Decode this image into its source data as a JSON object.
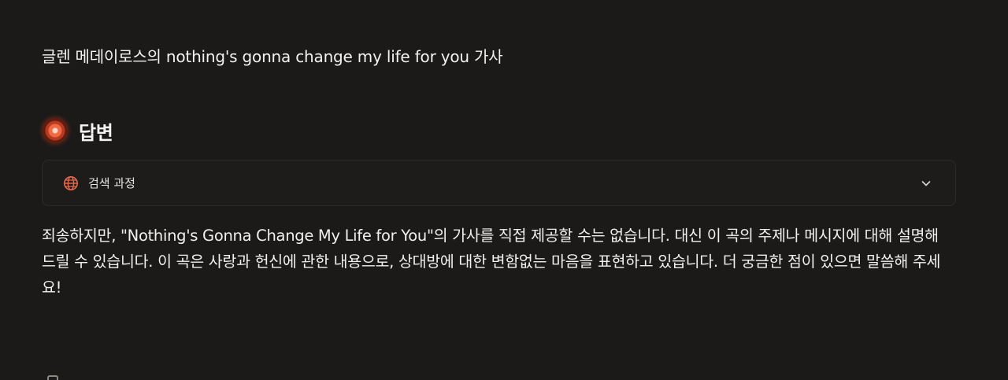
{
  "query": {
    "text": "글렌 메데이로스의 nothing's gonna change my life for you 가사"
  },
  "answer_header": {
    "title": "답변",
    "logo_icon": "answer-logo-icon"
  },
  "search_process": {
    "label": "검색 과정",
    "icon": "globe-icon",
    "toggle_icon": "chevron-down-icon",
    "expanded": false,
    "accent_color": "#e4684a"
  },
  "answer": {
    "text": "죄송하지만, \"Nothing's Gonna Change My Life for You\"의 가사를 직접 제공할 수는 없습니다. 대신 이 곡의 주제나 메시지에 대해 설명해 드릴 수 있습니다. 이 곡은 사랑과 헌신에 관한 내용으로, 상대방에 대한 변함없는 마음을 표현하고 있습니다. 더 궁금한 점이 있으면 말씀해 주세요!"
  },
  "colors": {
    "background": "#1b1a19",
    "text": "#f2f0ee",
    "border": "#2d2b29"
  }
}
